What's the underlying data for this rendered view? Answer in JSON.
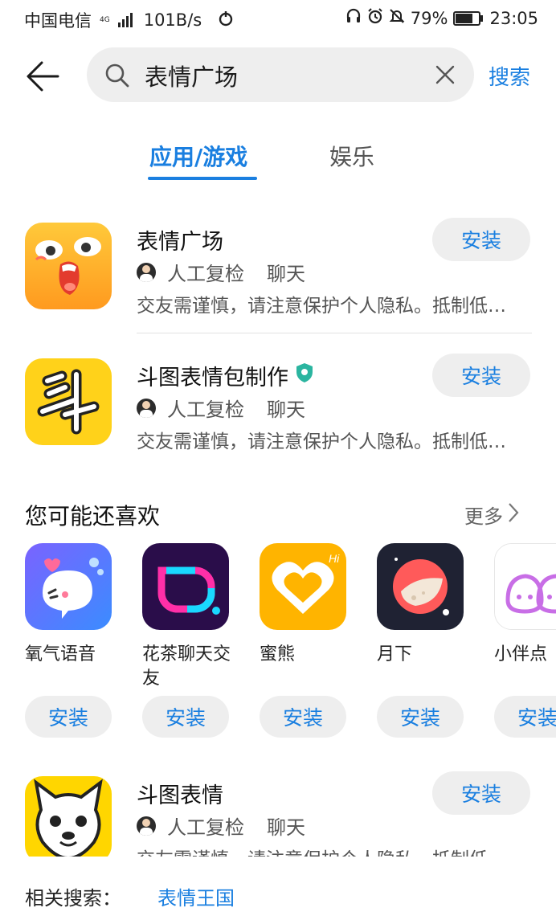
{
  "status_bar": {
    "carrier": "中国电信",
    "network": "4G",
    "speed": "101B/s",
    "battery": "79%",
    "battery_level": 0.79,
    "time": "23:05"
  },
  "search": {
    "query": "表情广场",
    "button_label": "搜索"
  },
  "tabs": [
    {
      "label": "应用/游戏",
      "active": true
    },
    {
      "label": "娱乐",
      "active": false
    }
  ],
  "results": [
    {
      "name": "表情广场",
      "review": "人工复检",
      "category": "聊天",
      "description": "交友需谨慎，请注意保护个人隐私。抵制低俗信息，文明交友。",
      "install_label": "安装"
    },
    {
      "name": "斗图表情包制作",
      "review": "人工复检",
      "category": "聊天",
      "description": "交友需谨慎，请注意保护个人隐私。抵制低俗信息，文明交友。",
      "install_label": "安装"
    },
    {
      "name": "斗图表情",
      "review": "人工复检",
      "category": "聊天",
      "description": "交友需谨慎，请注意保护个人隐私。抵制低俗信息，文明交友。",
      "install_label": "安装"
    }
  ],
  "recommend": {
    "title": "您可能还喜欢",
    "more_label": "更多",
    "items": [
      {
        "name": "氧气语音",
        "install_label": "安装"
      },
      {
        "name": "花茶聊天交友",
        "install_label": "安装"
      },
      {
        "name": "蜜熊",
        "install_label": "安装"
      },
      {
        "name": "月下",
        "install_label": "安装"
      },
      {
        "name": "小伴点",
        "install_label": "安装"
      }
    ]
  },
  "related": {
    "label": "相关搜索：",
    "items": [
      "表情王国"
    ]
  },
  "colors": {
    "accent": "#1a7fe0",
    "button_bg": "#eeeeee"
  }
}
